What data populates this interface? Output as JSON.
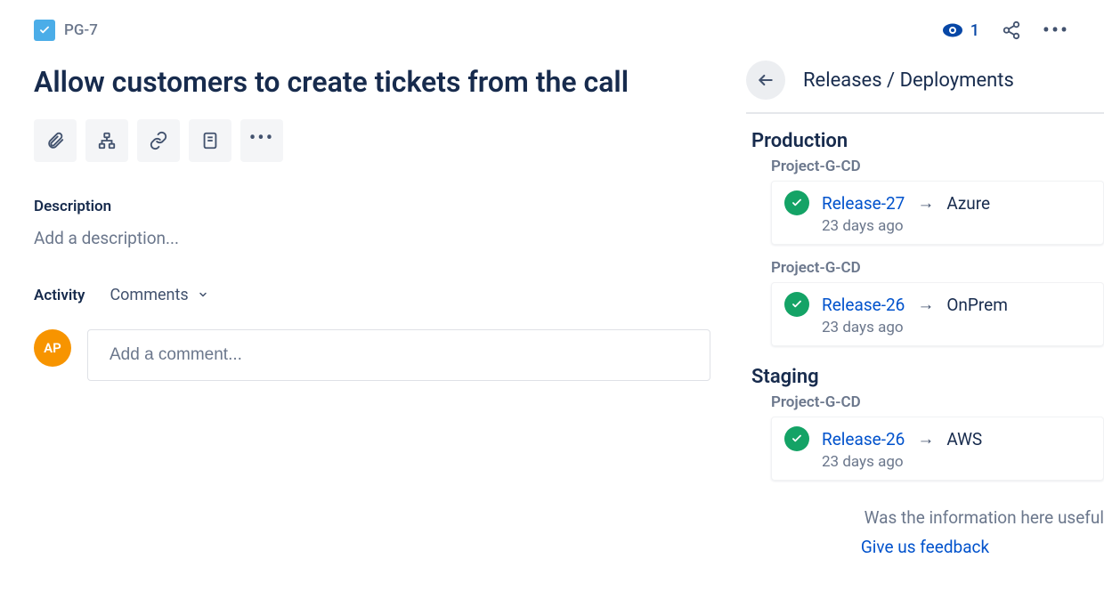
{
  "breadcrumb": {
    "issue_key": "PG-7"
  },
  "header": {
    "watch_count": "1",
    "title": "Allow customers to create tickets from the call"
  },
  "description": {
    "label": "Description",
    "placeholder": "Add a description..."
  },
  "activity": {
    "label": "Activity",
    "filter": "Comments"
  },
  "comment": {
    "avatar_initials": "AP",
    "placeholder": "Add a comment..."
  },
  "panel": {
    "title": "Releases / Deployments",
    "environments": [
      {
        "name": "Production",
        "project": "Project-G-CD",
        "releases": [
          {
            "name": "Release-27",
            "target": "Azure",
            "time": "23 days ago",
            "status": "success"
          },
          {
            "name": "Release-26",
            "target": "OnPrem",
            "time": "23 days ago",
            "status": "success"
          }
        ]
      },
      {
        "name": "Staging",
        "project": "Project-G-CD",
        "releases": [
          {
            "name": "Release-26",
            "target": "AWS",
            "time": "23 days ago",
            "status": "success"
          }
        ]
      }
    ],
    "feedback_question": "Was the information here useful",
    "feedback_link": "Give us feedback"
  },
  "arrow_glyph": "→"
}
